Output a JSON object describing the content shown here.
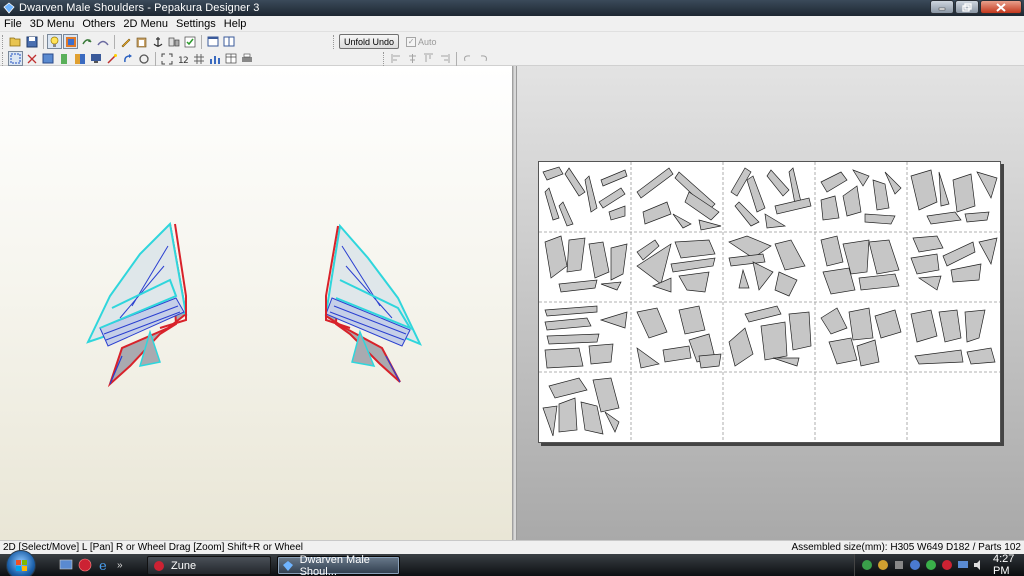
{
  "window": {
    "title": "Dwarven Male Shoulders - Pepakura Designer 3"
  },
  "menu": {
    "items": [
      "File",
      "3D Menu",
      "Others",
      "2D Menu",
      "Settings",
      "Help"
    ]
  },
  "toolbar": {
    "unfold_undo_label": "Unfold Undo",
    "auto_label": "Auto",
    "auto_checked": true
  },
  "status": {
    "left": "2D [Select/Move] L [Pan] R or Wheel Drag [Zoom] Shift+R or Wheel",
    "right": "Assembled size(mm): H305 W649 D182 / Parts 102"
  },
  "taskbar": {
    "items": [
      {
        "label": "Zune",
        "icon": "zune-icon"
      },
      {
        "label": "Dwarven Male Shoul...",
        "icon": "pepakura-icon"
      }
    ],
    "quick_launch_chevron": "»",
    "clock": "4:27 PM"
  },
  "colors": {
    "model_cyan": "#2fd6dc",
    "model_red": "#d8222a",
    "model_blue": "#2a3fd0",
    "model_gray": "#a9aab0"
  }
}
